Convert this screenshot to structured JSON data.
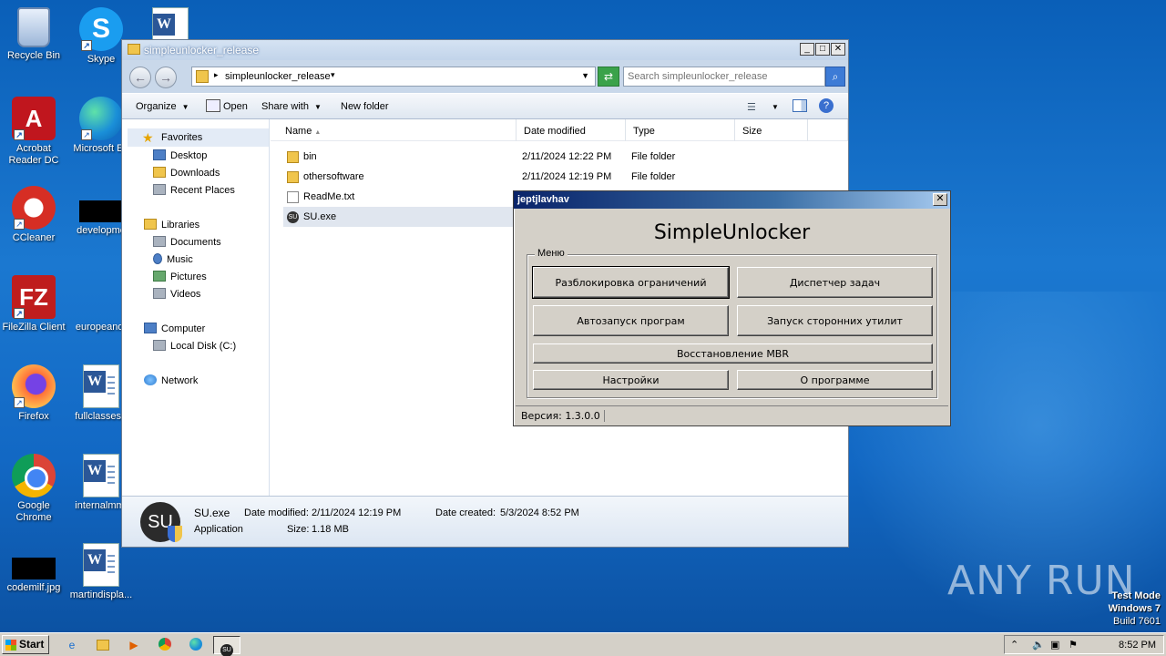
{
  "desktop": {
    "icons": [
      {
        "label": "Recycle Bin"
      },
      {
        "label": "Skype"
      },
      {
        "label": "Acrobat Reader DC"
      },
      {
        "label": "Microsoft Ed"
      },
      {
        "label": "CCleaner"
      },
      {
        "label": "developme"
      },
      {
        "label": "FileZilla Client"
      },
      {
        "label": "europeandr"
      },
      {
        "label": "Firefox"
      },
      {
        "label": "fullclasses.r"
      },
      {
        "label": "Google Chrome"
      },
      {
        "label": "internalmm."
      },
      {
        "label": "codemilf.jpg"
      },
      {
        "label": "martindispla..."
      }
    ]
  },
  "explorer": {
    "title": "simpleunlocker_release",
    "address_path": "simpleunlocker_release",
    "search_placeholder": "Search simpleunlocker_release",
    "toolbar": {
      "organize": "Organize",
      "open": "Open",
      "share_with": "Share with",
      "new_folder": "New folder"
    },
    "nav": {
      "favorites": "Favorites",
      "desktop": "Desktop",
      "downloads": "Downloads",
      "recent_places": "Recent Places",
      "libraries": "Libraries",
      "documents": "Documents",
      "music": "Music",
      "pictures": "Pictures",
      "videos": "Videos",
      "computer": "Computer",
      "local_disk": "Local Disk (C:)",
      "network": "Network"
    },
    "columns": {
      "name": "Name",
      "date_modified": "Date modified",
      "type": "Type",
      "size": "Size"
    },
    "files": [
      {
        "name": "bin",
        "date": "2/11/2024 12:22 PM",
        "type": "File folder"
      },
      {
        "name": "othersoftware",
        "date": "2/11/2024 12:19 PM",
        "type": "File folder"
      },
      {
        "name": "ReadMe.txt",
        "date": "",
        "type": ""
      },
      {
        "name": "SU.exe",
        "date": "",
        "type": ""
      }
    ],
    "details": {
      "name": "SU.exe",
      "type": "Application",
      "date_modified_label": "Date modified:",
      "date_modified": "2/11/2024 12:19 PM",
      "size_label": "Size:",
      "size": "1.18 MB",
      "date_created_label": "Date created:",
      "date_created": "5/3/2024 8:52 PM",
      "icon_text": "SU"
    }
  },
  "dialog": {
    "title": "jeptjlavhav",
    "heading": "SimpleUnlocker",
    "group_label": "Меню",
    "buttons": {
      "unlock": "Разблокировка ограничений",
      "task_manager": "Диспетчер задач",
      "autorun": "Автозапуск програм",
      "third_party": "Запуск сторонних утилит",
      "mbr": "Восстановление MBR",
      "settings": "Настройки",
      "about": "О программе"
    },
    "version": "Версия: 1.3.0.0"
  },
  "taskbar": {
    "start": "Start",
    "time": "8:52 PM"
  },
  "watermark": "ANY RUN",
  "test_mode": {
    "line1": "Test Mode",
    "line2": "Windows 7",
    "line3": "Build 7601"
  }
}
